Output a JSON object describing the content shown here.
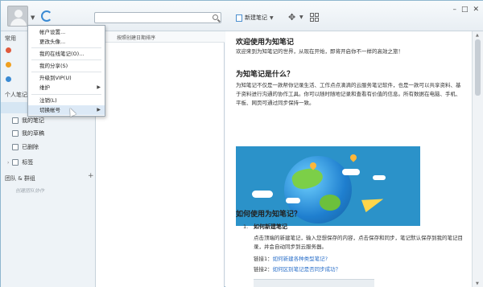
{
  "topbar": {
    "new_note_label": "新建笔记"
  },
  "sidebar": {
    "section_common": "常用",
    "items": [
      {
        "label": "我的笔记"
      },
      {
        "label": "我的草稿"
      },
      {
        "label": "已删除"
      },
      {
        "label": "标签"
      }
    ],
    "section_personal": "个人笔记",
    "section_team": "团队 & 群组",
    "team_hint": "创建团队协作"
  },
  "notelist": {
    "sort_label": "按照创建日期排序"
  },
  "menu": {
    "items": [
      {
        "label": "帐户设置..."
      },
      {
        "label": "更改头像..."
      },
      {
        "label": "我的在线笔记(O)..."
      },
      {
        "label": "我的分享(S)"
      },
      {
        "label": "升级到VIP(U)"
      },
      {
        "label": "维护"
      },
      {
        "label": "注销(L)"
      },
      {
        "label": "切换帐号"
      }
    ]
  },
  "content": {
    "h_welcome": "欢迎使用为知笔记",
    "p_welcome": "欢迎来到为知笔记的世界，从现在开始，即将开启你不一样的高效之旅！",
    "h_what": "为知笔记是什么？",
    "p_what": "为知笔记不仅是一款帮你记录生活、工作点点滴滴的云服务笔记软件，也是一款可以共享资料、基于资料进行沟通的协作工具。你可以随时随地记录和查看有价值的信息。所有数据在电脑、手机、平板、网页可通过同步保持一致。",
    "h_how": "如何使用为知笔记？",
    "step_num": "1.",
    "step_title": "如何新建笔记",
    "step_text": "点击顶端的新建笔记，输入您想保存的内容，点击保存和同步，笔记默认保存到我的笔记目录，并会自动同步到云服务器。",
    "link1_prefix": "链接1：",
    "link1_text": "如何新建各种类型笔记?",
    "link2_prefix": "链接2：",
    "link2_text": "如何区别笔记是否同步成功？"
  }
}
